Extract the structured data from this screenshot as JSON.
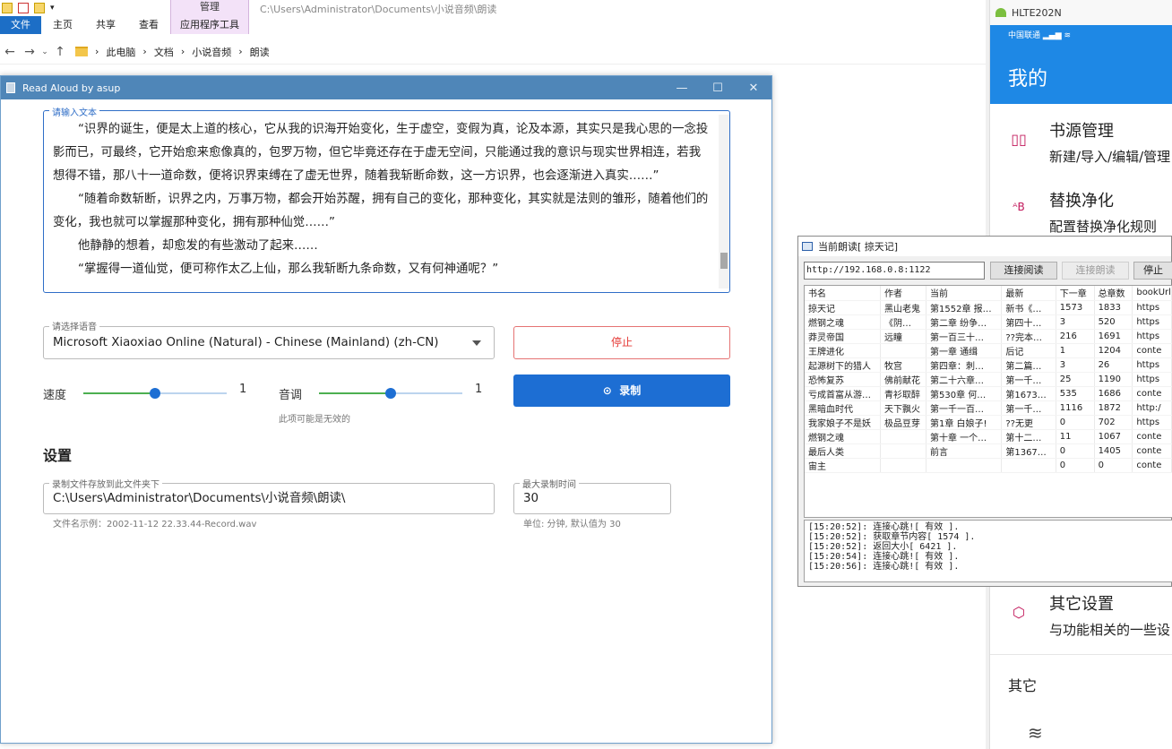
{
  "explorer": {
    "ribbon_tabs": [
      "文件",
      "主页",
      "共享",
      "查看"
    ],
    "context_group_label": "管理",
    "context_tab": "应用程序工具",
    "title_path": "C:\\Users\\Administrator\\Documents\\小说音频\\朗读",
    "breadcrumbs": [
      "此电脑",
      "文档",
      "小说音频",
      "朗读"
    ]
  },
  "read_aloud": {
    "title": "Read Aloud by asup",
    "text_legend": "请输入文本",
    "paragraphs": [
      "“识界的诞生，便是太上道的核心，它从我的识海开始变化，生于虚空，变假为真，论及本源，其实只是我心思的一念投影而已，可最终，它开始愈来愈像真的，包罗万物，但它毕竟还存在于虚无空间，只能通过我的意识与现实世界相连，若我想得不错，那八十一道命数，便将识界束缚在了虚无世界，随着我斩断命数，这一方识界，也会逐渐进入真实……”",
      "“随着命数斩断，识界之内，万事万物，都会开始苏醒，拥有自己的变化，那种变化，其实就是法则的雏形，随着他们的变化，我也就可以掌握那种变化，拥有那种仙觉……”",
      "他静静的想着，却愈发的有些激动了起来……",
      "“掌握得一道仙觉，便可称作太乙上仙，那么我斩断九条命数，又有何神通呢？”"
    ],
    "voice_legend": "请选择语音",
    "voice_value": "Microsoft Xiaoxiao Online (Natural) - Chinese (Mainland) (zh-CN)",
    "stop_label": "停止",
    "record_label": "录制",
    "speed_label": "速度",
    "speed_value": "1",
    "speed_level": 0.5,
    "pitch_label": "音调",
    "pitch_value": "1",
    "pitch_level": 0.5,
    "pitch_hint": "此项可能是无效的",
    "settings_heading": "设置",
    "folder_legend": "录制文件存放到此文件夹下",
    "folder_value": "C:\\Users\\Administrator\\Documents\\小说音频\\朗读\\",
    "folder_hint": "文件名示例：2002-11-12 22.33.44-Record.wav",
    "maxtime_legend": "最大录制时间",
    "maxtime_value": "30",
    "maxtime_hint": "单位: 分钟, 默认值为 30"
  },
  "phone": {
    "device": "HLTE202N",
    "carrier": "中国联通",
    "header_title": "我的",
    "items": [
      {
        "icon": "book-icon",
        "title": "书源管理",
        "subtitle": "新建/导入/编辑/管理"
      },
      {
        "icon": "replace-icon",
        "title": "替换净化",
        "subtitle": "配置替换净化规则"
      },
      {
        "icon": "settings-icon",
        "title": "其它设置",
        "subtitle": "与功能相关的一些设"
      }
    ],
    "section_other": "其它"
  },
  "reader_window": {
    "title": "当前朗读[ 掠天记]",
    "url": "http://192.168.0.8:1122",
    "btn_connect": "连接阅读",
    "btn_connect_read": "连接朗读",
    "btn_stop": "停止",
    "columns": [
      "书名",
      "作者",
      "当前",
      "最新",
      "下一章",
      "总章数",
      "bookUrl"
    ],
    "rows": [
      [
        "掠天记",
        "黑山老鬼",
        "第1552章 报…",
        "新书《…",
        "1573",
        "1833",
        "https"
      ],
      [
        "燃钢之魂",
        "《阴…",
        "第二章 纷争…",
        "第四十…",
        "3",
        "520",
        "https"
      ],
      [
        "莽灵帝国",
        "远瞳",
        "第一百三十…",
        "??完本…",
        "216",
        "1691",
        "https"
      ],
      [
        "王牌进化",
        "",
        "第一章 通缉",
        "后记",
        "1",
        "1204",
        "conte"
      ],
      [
        "起源树下的猎人",
        "牧宫",
        "第四章：刺…",
        "第二篇…",
        "3",
        "26",
        "https"
      ],
      [
        "恐怖复苏",
        "佛前献花",
        "第二十六章…",
        "第一千…",
        "25",
        "1190",
        "https"
      ],
      [
        "亏成首富从游…",
        "青衫取醉",
        "第530章 何…",
        "第1673…",
        "535",
        "1686",
        "conte"
      ],
      [
        "黑暗血时代",
        "天下飘火",
        "第一千一百…",
        "第一千…",
        "1116",
        "1872",
        "http:/"
      ],
      [
        "我家娘子不是妖",
        "极品豆芽",
        "第1章 白娘子!",
        "??无更",
        "0",
        "702",
        "https"
      ],
      [
        "燃钢之魂",
        "",
        "第十章 一个…",
        "第十二…",
        "11",
        "1067",
        "conte"
      ],
      [
        "最后人类",
        "",
        "前言",
        "第1367…",
        "0",
        "1405",
        "conte"
      ],
      [
        "宙主",
        "",
        "",
        "",
        "0",
        "0",
        "conte"
      ]
    ],
    "log": [
      "[15:20:52]: 连接心跳![ 有效 ].",
      "[15:20:52]: 获取章节内容[ 1574 ].",
      "[15:20:52]: 返回大小[ 6421 ].",
      "[15:20:54]: 连接心跳![ 有效 ].",
      "[15:20:56]: 连接心跳![ 有效 ]."
    ]
  }
}
